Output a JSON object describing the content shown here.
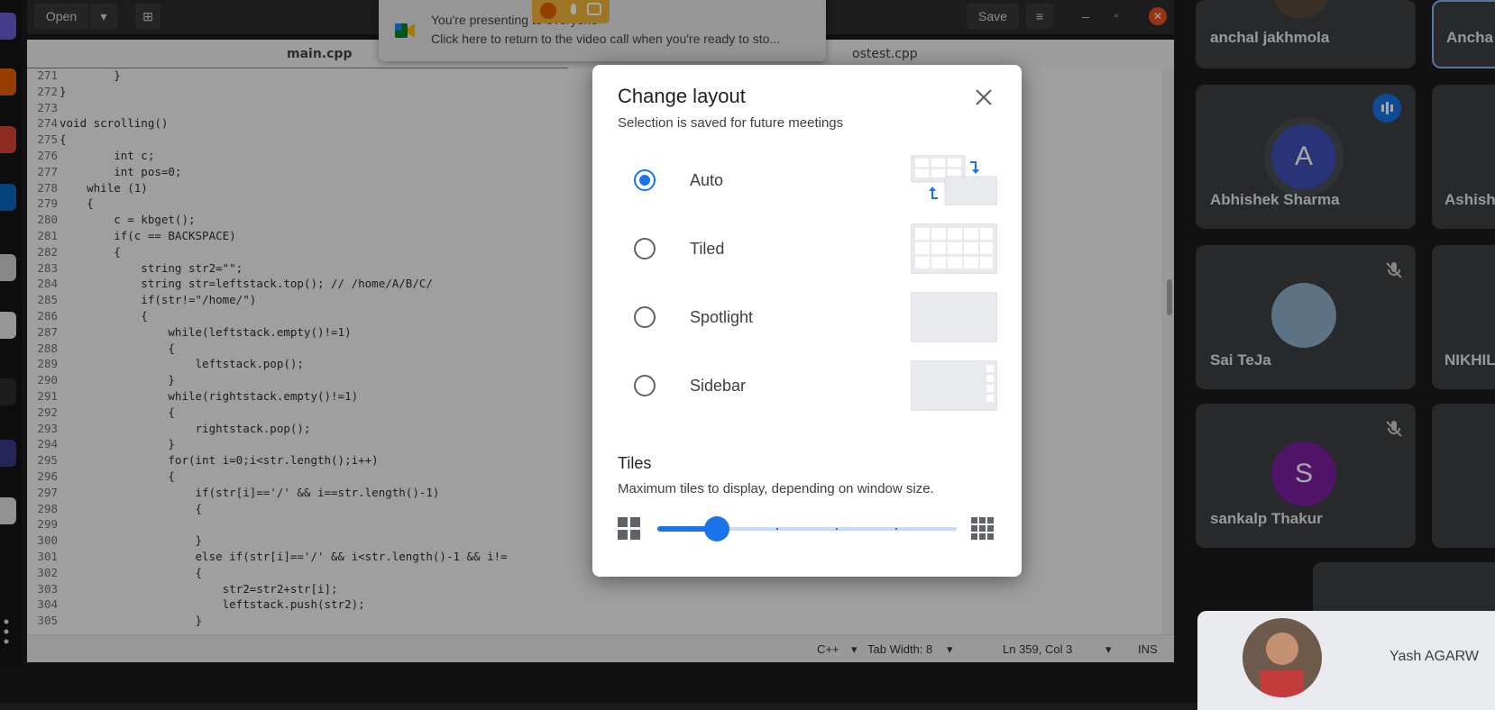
{
  "editor": {
    "open_label": "Open",
    "save_label": "Save",
    "tabs": [
      "main.cpp",
      "ostest.cpp"
    ],
    "code_lines": [
      {
        "n": "271",
        "text": "        }"
      },
      {
        "n": "272",
        "text": "}"
      },
      {
        "n": "273",
        "text": ""
      },
      {
        "n": "274",
        "text": "void scrolling()"
      },
      {
        "n": "275",
        "text": "{"
      },
      {
        "n": "276",
        "text": "        int c;"
      },
      {
        "n": "277",
        "text": "        int pos=0;"
      },
      {
        "n": "278",
        "text": "    while (1)"
      },
      {
        "n": "279",
        "text": "    {"
      },
      {
        "n": "280",
        "text": "        c = kbget();"
      },
      {
        "n": "281",
        "text": "        if(c == BACKSPACE)"
      },
      {
        "n": "282",
        "text": "        {"
      },
      {
        "n": "283",
        "text": "            string str2=\"\";"
      },
      {
        "n": "284",
        "text": "            string str=leftstack.top(); // /home/A/B/C/"
      },
      {
        "n": "285",
        "text": "            if(str!=\"/home/\")"
      },
      {
        "n": "286",
        "text": "            {"
      },
      {
        "n": "287",
        "text": "                while(leftstack.empty()!=1)"
      },
      {
        "n": "288",
        "text": "                {"
      },
      {
        "n": "289",
        "text": "                    leftstack.pop();"
      },
      {
        "n": "290",
        "text": "                }"
      },
      {
        "n": "291",
        "text": "                while(rightstack.empty()!=1)"
      },
      {
        "n": "292",
        "text": "                {"
      },
      {
        "n": "293",
        "text": "                    rightstack.pop();"
      },
      {
        "n": "294",
        "text": "                }"
      },
      {
        "n": "295",
        "text": "                for(int i=0;i<str.length();i++)"
      },
      {
        "n": "296",
        "text": "                {"
      },
      {
        "n": "297",
        "text": "                    if(str[i]=='/' && i==str.length()-1)"
      },
      {
        "n": "298",
        "text": "                    {"
      },
      {
        "n": "299",
        "text": ""
      },
      {
        "n": "300",
        "text": "                    }"
      },
      {
        "n": "301",
        "text": "                    else if(str[i]=='/' && i<str.length()-1 && i!="
      },
      {
        "n": "302",
        "text": "                    {"
      },
      {
        "n": "303",
        "text": "                        str2=str2+str[i];"
      },
      {
        "n": "304",
        "text": "                        leftstack.push(str2);"
      },
      {
        "n": "305",
        "text": "                    }"
      }
    ],
    "status": {
      "language": "C++",
      "tab_width": "Tab Width: 8",
      "position": "Ln 359, Col 3",
      "mode": "INS"
    }
  },
  "notification": {
    "line1": "You're presenting to everyone",
    "line2": "Click here to return to the video call when you're ready to sto..."
  },
  "participants": [
    {
      "name": "anchal jakhmola"
    },
    {
      "name": "Ancha"
    },
    {
      "name": "Abhishek Sharma",
      "initial": "A"
    },
    {
      "name": "Ashish"
    },
    {
      "name": "Sai TeJa"
    },
    {
      "name": "NIKHIL"
    },
    {
      "name": "sankalp Thakur",
      "initial": "S"
    },
    {
      "name": "Yash AGARW"
    }
  ],
  "dialog": {
    "title": "Change layout",
    "subtitle": "Selection is saved for future meetings",
    "options": [
      {
        "label": "Auto",
        "selected": true
      },
      {
        "label": "Tiled",
        "selected": false
      },
      {
        "label": "Spotlight",
        "selected": false
      },
      {
        "label": "Sidebar",
        "selected": false
      }
    ],
    "tiles_title": "Tiles",
    "tiles_subtitle": "Maximum tiles to display, depending on window size.",
    "slider_value_fraction": 0.18,
    "accent": "#1a73e8"
  }
}
